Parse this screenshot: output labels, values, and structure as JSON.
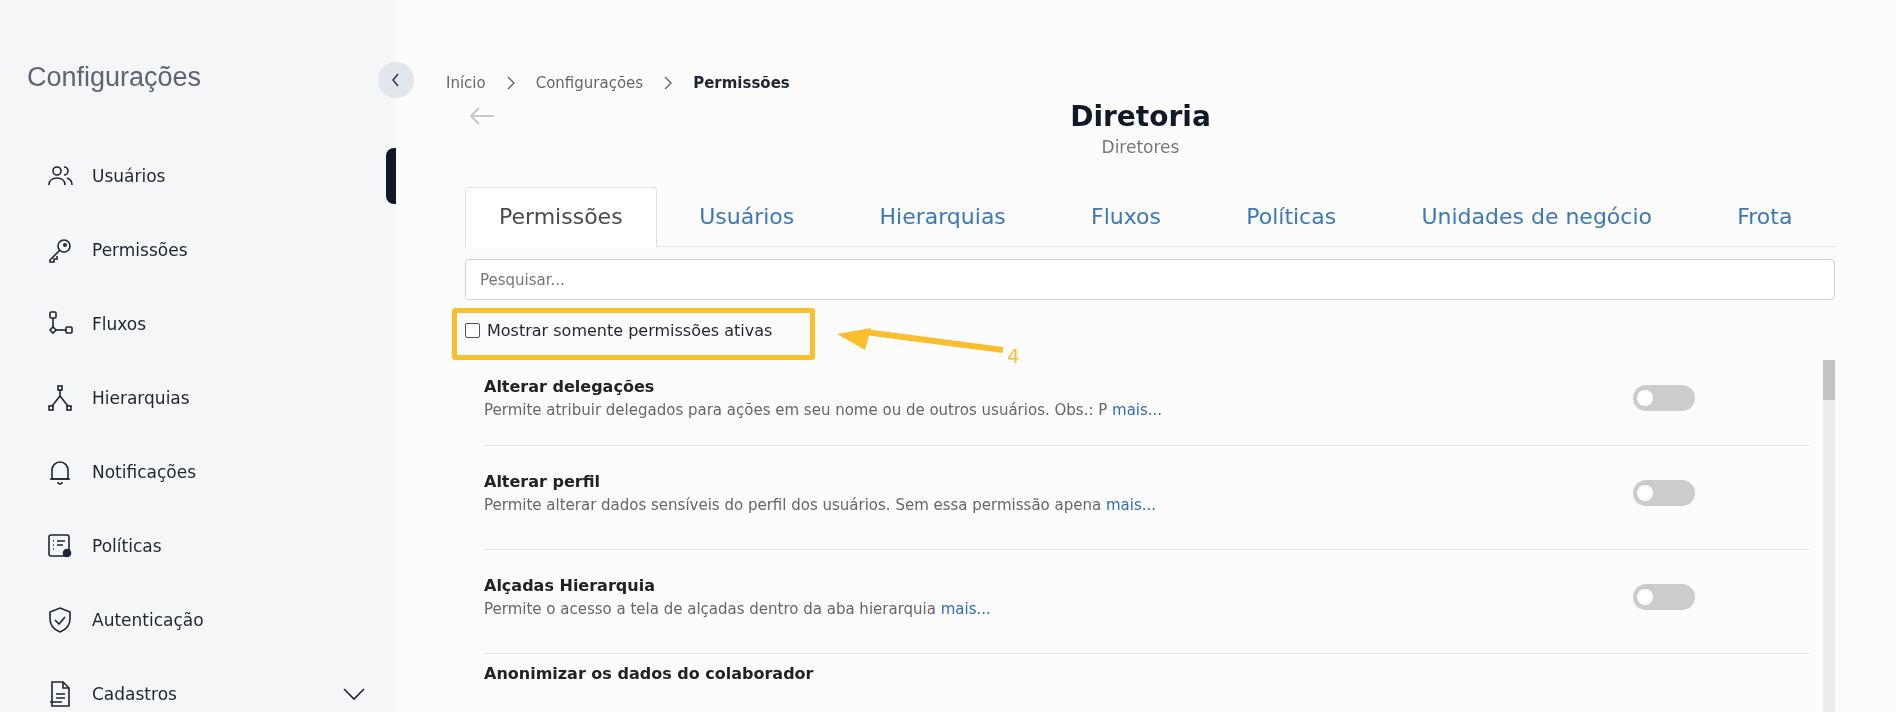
{
  "sidebar": {
    "title": "Configurações",
    "items": [
      {
        "label": "Usuários",
        "expandable": false
      },
      {
        "label": "Permissões",
        "expandable": false
      },
      {
        "label": "Fluxos",
        "expandable": false
      },
      {
        "label": "Hierarquias",
        "expandable": false
      },
      {
        "label": "Notificações",
        "expandable": false
      },
      {
        "label": "Políticas",
        "expandable": false
      },
      {
        "label": "Autenticação",
        "expandable": false
      },
      {
        "label": "Cadastros",
        "expandable": true
      }
    ]
  },
  "breadcrumb": [
    "Início",
    "Configurações",
    "Permissões"
  ],
  "header": {
    "title": "Diretoria",
    "subtitle": "Diretores"
  },
  "tabs": [
    {
      "label": "Permissões",
      "selected": true
    },
    {
      "label": "Usuários",
      "selected": false
    },
    {
      "label": "Hierarquias",
      "selected": false
    },
    {
      "label": "Fluxos",
      "selected": false
    },
    {
      "label": "Políticas",
      "selected": false
    },
    {
      "label": "Unidades de negócio",
      "selected": false
    },
    {
      "label": "Frota",
      "selected": false
    }
  ],
  "search": {
    "placeholder": "Pesquisar..."
  },
  "filter": {
    "label": "Mostrar somente permissões ativas",
    "checked": false
  },
  "annotation": {
    "label": "4"
  },
  "permissions": [
    {
      "title": "Alterar delegações",
      "description": "Permite atribuir delegados para ações em seu nome ou de outros usuários. Obs.: P",
      "more": "mais...",
      "on": false
    },
    {
      "title": "Alterar perfil",
      "description": "Permite alterar dados sensíveis do perfil dos usuários. Sem essa permissão apena",
      "more": "mais...",
      "on": false
    },
    {
      "title": "Alçadas Hierarquia",
      "description": "Permite o acesso a tela de alçadas dentro da aba hierarquia",
      "more": "mais...",
      "on": false
    },
    {
      "title": "Anonimizar os dados do colaborador"
    }
  ]
}
